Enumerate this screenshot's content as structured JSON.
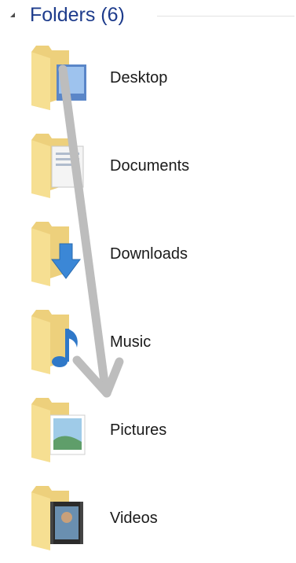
{
  "group": {
    "title": "Folders (6)",
    "expanded": true
  },
  "folders": [
    {
      "name": "Desktop",
      "icon": "desktop-folder-icon"
    },
    {
      "name": "Documents",
      "icon": "documents-folder-icon"
    },
    {
      "name": "Downloads",
      "icon": "downloads-folder-icon"
    },
    {
      "name": "Music",
      "icon": "music-folder-icon"
    },
    {
      "name": "Pictures",
      "icon": "pictures-folder-icon"
    },
    {
      "name": "Videos",
      "icon": "videos-folder-icon"
    }
  ],
  "colors": {
    "folder_back": "#e8c76a",
    "folder_front": "#f6df92",
    "title": "#1e3c8c",
    "arrow": "#b8b8b8"
  }
}
